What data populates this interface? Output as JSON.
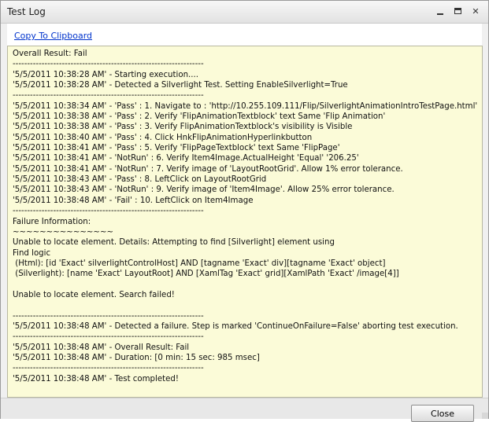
{
  "window": {
    "title": "Test Log",
    "minimize_label": "minimize",
    "maximize_label": "maximize",
    "close_glyph": "✕"
  },
  "toolbar": {
    "copy_link": "Copy To Clipboard"
  },
  "log": {
    "lines": [
      "Overall Result: Fail",
      "------------------------------------------------------------------",
      "'5/5/2011 10:38:28 AM' - Starting execution....",
      "'5/5/2011 10:38:28 AM' - Detected a Silverlight Test. Setting EnableSilverlight=True",
      "------------------------------------------------------------------",
      "'5/5/2011 10:38:34 AM' - 'Pass' : 1. Navigate to : 'http://10.255.109.111/Flip/SilverlightAnimationIntroTestPage.html'",
      "'5/5/2011 10:38:38 AM' - 'Pass' : 2. Verify 'FlipAnimationTextblock' text Same 'Flip Animation'",
      "'5/5/2011 10:38:38 AM' - 'Pass' : 3. Verify FlipAnimationTextblock's visibility is Visible",
      "'5/5/2011 10:38:40 AM' - 'Pass' : 4. Click HnkFlipAnimationHyperlinkbutton",
      "'5/5/2011 10:38:41 AM' - 'Pass' : 5. Verify 'FlipPageTextblock' text Same 'FlipPage'",
      "'5/5/2011 10:38:41 AM' - 'NotRun' : 6. Verify Item4Image.ActualHeight 'Equal' '206.25'",
      "'5/5/2011 10:38:41 AM' - 'NotRun' : 7. Verify image of 'LayoutRootGrid'. Allow 1% error tolerance.",
      "'5/5/2011 10:38:43 AM' - 'Pass' : 8. LeftClick on LayoutRootGrid",
      "'5/5/2011 10:38:43 AM' - 'NotRun' : 9. Verify image of 'Item4Image'. Allow 25% error tolerance.",
      "'5/5/2011 10:38:48 AM' - 'Fail' : 10. LeftClick on Item4Image",
      "------------------------------------------------------------------",
      "Failure Information:",
      "~~~~~~~~~~~~~~~",
      "Unable to locate element. Details: Attempting to find [Silverlight] element using",
      "Find logic",
      " (Html): [id 'Exact' silverlightControlHost] AND [tagname 'Exact' div][tagname 'Exact' object]",
      " (Silverlight): [name 'Exact' LayoutRoot] AND [XamlTag 'Exact' grid][XamlPath 'Exact' /image[4]]",
      "",
      "Unable to locate element. Search failed!",
      "",
      "------------------------------------------------------------------",
      "'5/5/2011 10:38:48 AM' - Detected a failure. Step is marked 'ContinueOnFailure=False' aborting test execution.",
      "------------------------------------------------------------------",
      "'5/5/2011 10:38:48 AM' - Overall Result: Fail",
      "'5/5/2011 10:38:48 AM' - Duration: [0 min: 15 sec: 985 msec]",
      "------------------------------------------------------------------",
      "'5/5/2011 10:38:48 AM' - Test completed!"
    ]
  },
  "footer": {
    "close_label": "Close"
  }
}
